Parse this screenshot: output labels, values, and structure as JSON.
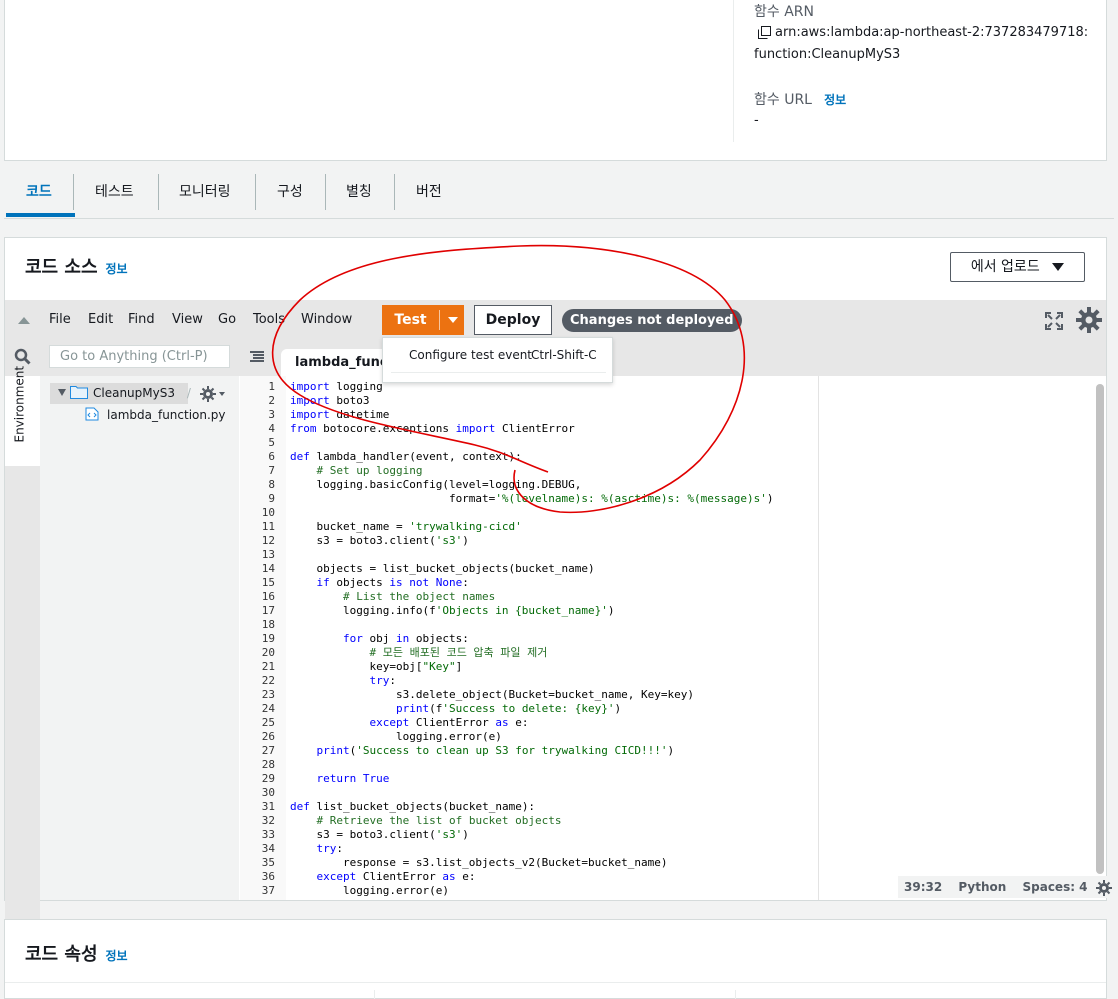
{
  "function_info": {
    "arn_label": "함수 ARN",
    "arn_line1": "arn:aws:lambda:ap-northeast-2:737283479718:",
    "arn_line2": "function:CleanupMyS3",
    "url_label": "함수 URL",
    "url_info": "정보",
    "url_value": "-"
  },
  "tabs": [
    "코드",
    "테스트",
    "모니터링",
    "구성",
    "별칭",
    "버전"
  ],
  "code_source": {
    "title": "코드 소스",
    "info": "정보",
    "upload_label": "에서 업로드"
  },
  "ide": {
    "menu": [
      "File",
      "Edit",
      "Find",
      "View",
      "Go",
      "Tools",
      "Window"
    ],
    "test_label": "Test",
    "deploy_label": "Deploy",
    "badge": "Changes not deployed",
    "dropdown_item": "Configure test event",
    "dropdown_shortcut": "Ctrl-Shift-C",
    "goto_placeholder": "Go to Anything (Ctrl-P)",
    "environment_label": "Environment",
    "folder": "CleanupMyS3",
    "folder_suffix": "/",
    "file": "lambda_function.py",
    "file_tab": "lambda_function.py",
    "status_position": "39:32",
    "status_lang": "Python",
    "status_spaces": "Spaces: 4"
  },
  "bottom": {
    "title": "코드 속성",
    "info": "정보"
  },
  "colors": {
    "accent": "#0073bb",
    "test_orange": "#ec7211",
    "annotation_red": "#e00000"
  }
}
